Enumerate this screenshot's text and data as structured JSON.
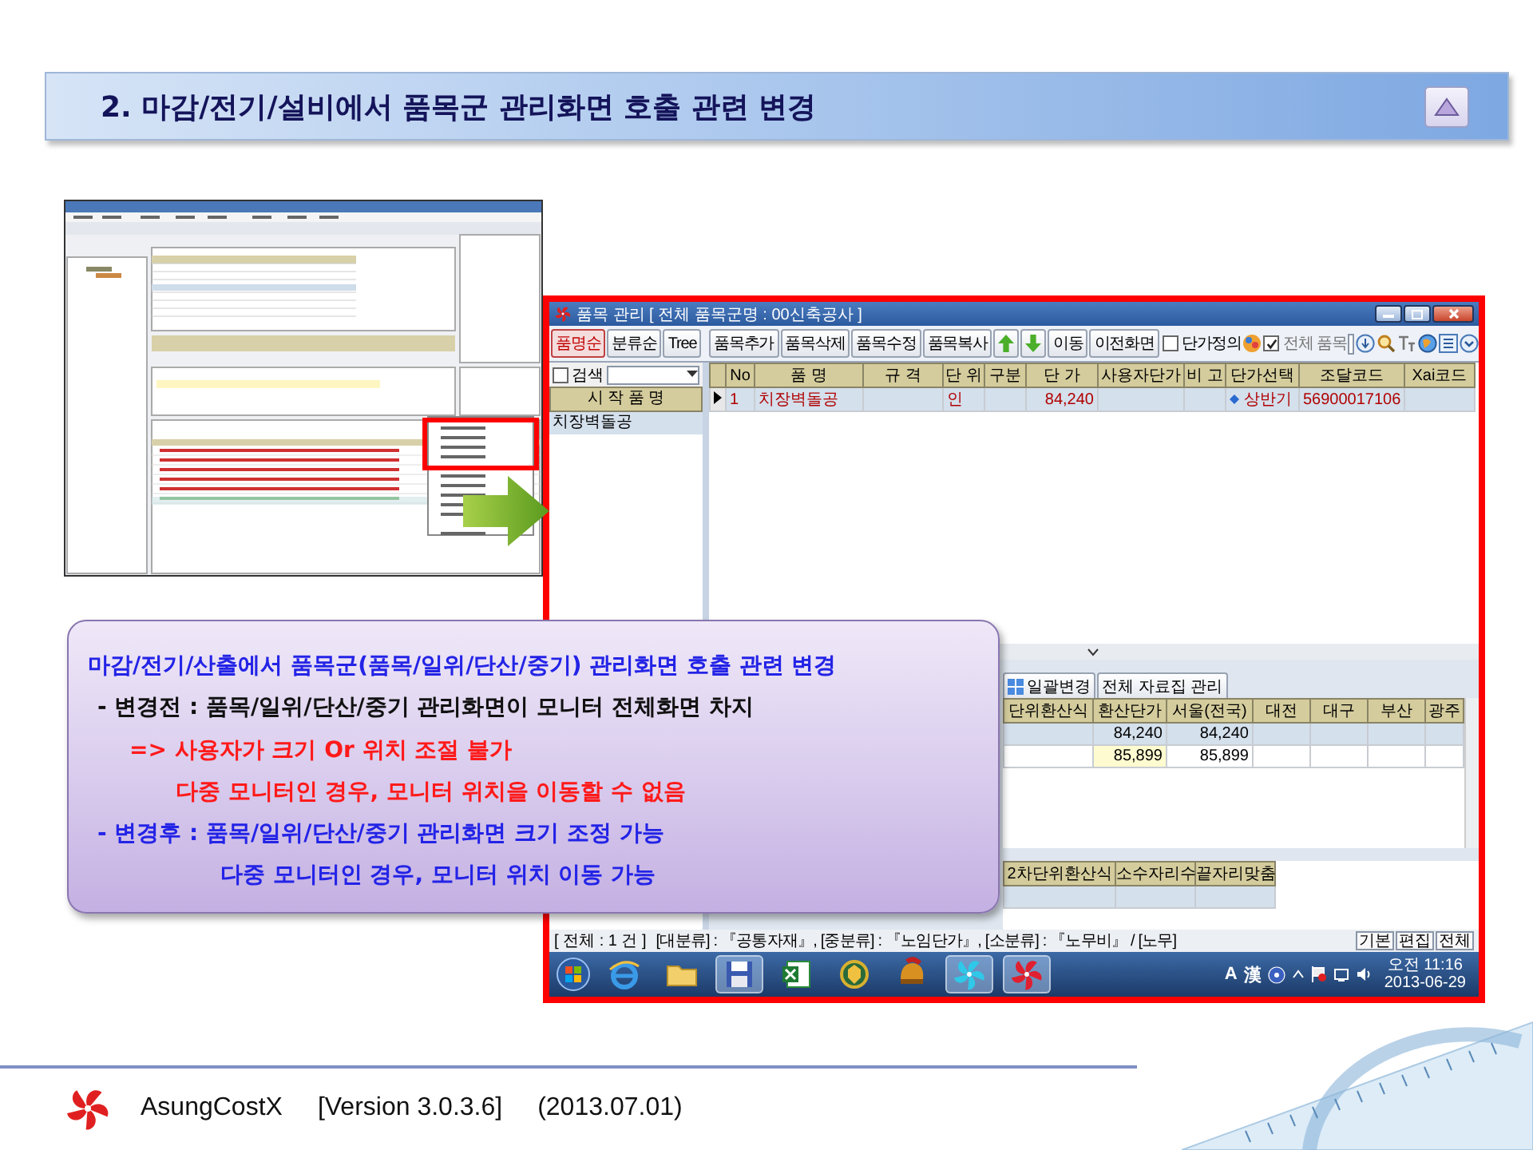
{
  "slide_title": "2. 마감/전기/설비에서 품목군 관리화면 호출 관련 변경",
  "item_window": {
    "title": "품목 관리 [ 전체 품목군명 : 00신축공사 ]",
    "sort_tabs": [
      {
        "label": "품명순",
        "selected": true
      },
      {
        "label": "분류순",
        "selected": false
      },
      {
        "label": "Tree",
        "selected": false
      }
    ],
    "toolbar_buttons": [
      {
        "kind": "text",
        "label": "품목추가"
      },
      {
        "kind": "text",
        "label": "품목삭제"
      },
      {
        "kind": "text",
        "label": "품목수정"
      },
      {
        "kind": "text",
        "label": "품목복사"
      },
      {
        "kind": "up_arrow"
      },
      {
        "kind": "down_arrow"
      },
      {
        "kind": "text",
        "label": "이동"
      },
      {
        "kind": "text",
        "label": "이전화면"
      }
    ],
    "price_definition": {
      "label": "단가정의",
      "checked": false
    },
    "all_items": {
      "label": "전체 품목",
      "checked": true
    },
    "search": {
      "label": "검색",
      "checked": false
    },
    "list_header": "시 작 품 명",
    "list_items": [
      {
        "label": "치장벽돌공",
        "selected": true
      }
    ],
    "columns": [
      "No",
      "품  명",
      "규  격",
      "단 위",
      "구분",
      "단  가",
      "사용자단가",
      "비 고",
      "단가선택",
      "조달코드",
      "Xai코드"
    ],
    "rows": [
      {
        "no": "1",
        "name": "치장벽돌공",
        "unit": "인",
        "price": "84,240",
        "price_select": "상반기",
        "procurement_code": "56900017106",
        "selected": true
      }
    ],
    "lower_buttons": [
      {
        "kind": "icon",
        "label": "일괄변경"
      },
      {
        "kind": "text",
        "label": "전체 자료집 관리"
      }
    ],
    "price_columns": [
      "단위환산식",
      "환산단가",
      "서울(전국)",
      "대전",
      "대구",
      "부산",
      "광주"
    ],
    "price_rows": [
      {
        "converted_price": "84,240",
        "seoul": "84,240",
        "selected": true,
        "current": false
      },
      {
        "converted_price": "85,899",
        "seoul": "85,899",
        "selected": false,
        "current": true
      }
    ],
    "unit_columns": [
      "2차단위환산식",
      "소수자리수",
      "끝자리맞춤"
    ],
    "status_bar": {
      "count": "[ 전체 : 1 건 ]",
      "path": "[대분류] : 『공통자재』, [중분류] : 『노임단가』, [소분류] : 『노무비』 / [노무]",
      "buttons": [
        "기본",
        "편집",
        "전체"
      ]
    }
  },
  "taskbar": {
    "ime": "A",
    "ime_mode": "漢",
    "time": "오전 11:16",
    "date": "2013-06-29"
  },
  "callout": [
    {
      "kind": "heading",
      "color": "#2323e6",
      "text": "마감/전기/산출에서 품목군(품목/일위/단산/중기) 관리화면 호출 관련 변경"
    },
    {
      "kind": "item",
      "color": "#111111",
      "text": "- 변경전 : 품목/일위/단산/중기 관리화면이 모니터 전체화면 차지"
    },
    {
      "kind": "note",
      "color": "#ff1a1a",
      "text": "=> 사용자가 크기 Or 위치 조절 불가"
    },
    {
      "kind": "note_detail",
      "color": "#ff1a1a",
      "text": "다중 모니터인 경우, 모니터 위치을 이동할 수 없음"
    },
    {
      "kind": "item",
      "color": "#2323e6",
      "text": "- 변경후 : 품목/일위/단산/중기 관리화면 크기 조정 가능"
    },
    {
      "kind": "item_detail",
      "color": "#2323e6",
      "text": "다중 모니터인 경우, 모니터 위치 이동 가능"
    }
  ],
  "footer": {
    "product": "AsungCostX",
    "version": "[Version 3.0.3.6]",
    "date": "(2013.07.01)"
  }
}
